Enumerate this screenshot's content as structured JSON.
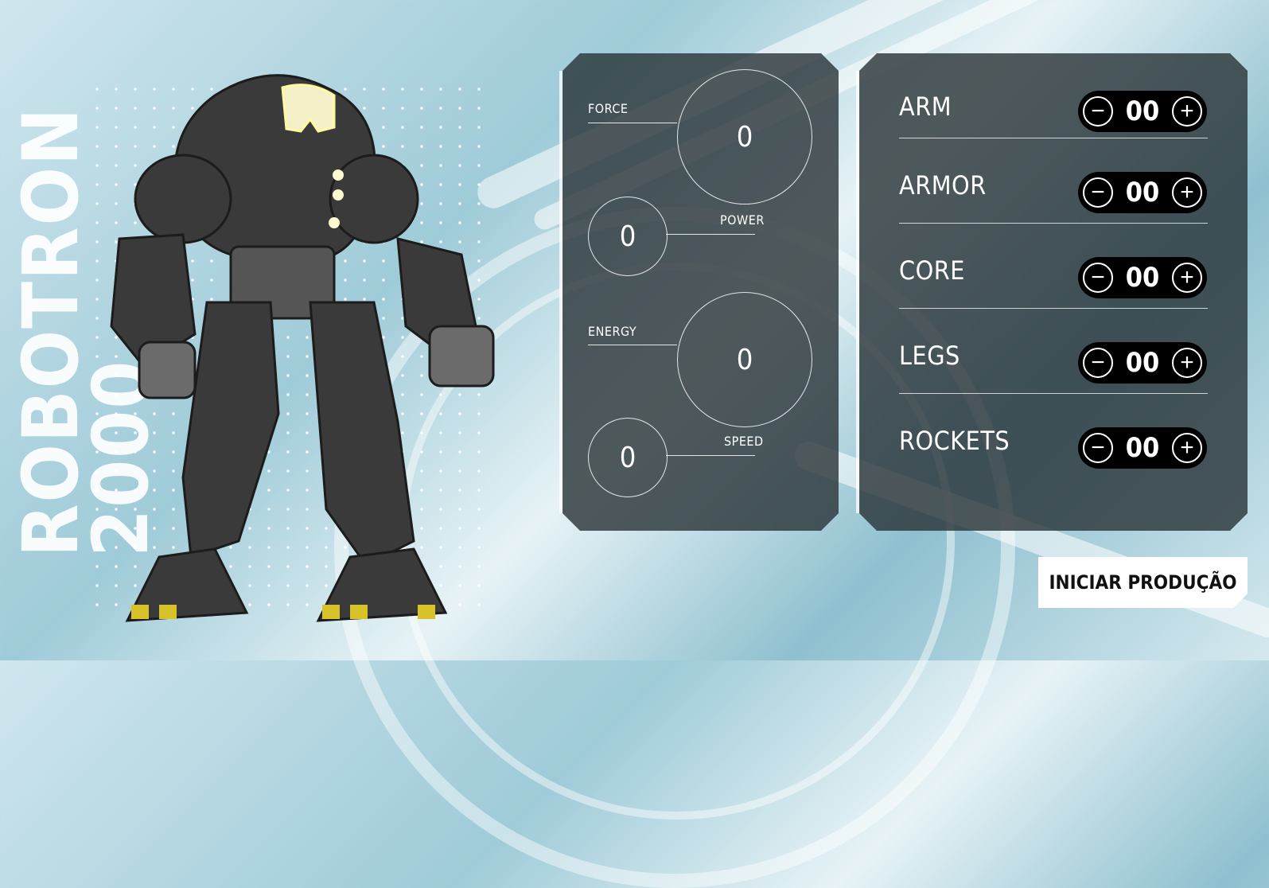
{
  "brand": {
    "line1": "ROBOTRON",
    "line2": "2000"
  },
  "robot": {
    "icon": "robot-icon",
    "visor_color": "#f4f1c8",
    "body_color": "#3a3a3a",
    "accent_color": "#d7c22a"
  },
  "stats": [
    {
      "label": "FORCE",
      "value": "0"
    },
    {
      "label": "POWER",
      "value": "0"
    },
    {
      "label": "ENERGY",
      "value": "0"
    },
    {
      "label": "SPEED",
      "value": "0"
    }
  ],
  "parts": [
    {
      "name": "ARM",
      "value": "00"
    },
    {
      "name": "ARMOR",
      "value": "00"
    },
    {
      "name": "CORE",
      "value": "00"
    },
    {
      "name": "LEGS",
      "value": "00"
    },
    {
      "name": "ROCKETS",
      "value": "00"
    }
  ],
  "controls": {
    "minus": "−",
    "plus": "+",
    "start_label": "INICIAR PRODUÇÃO"
  }
}
